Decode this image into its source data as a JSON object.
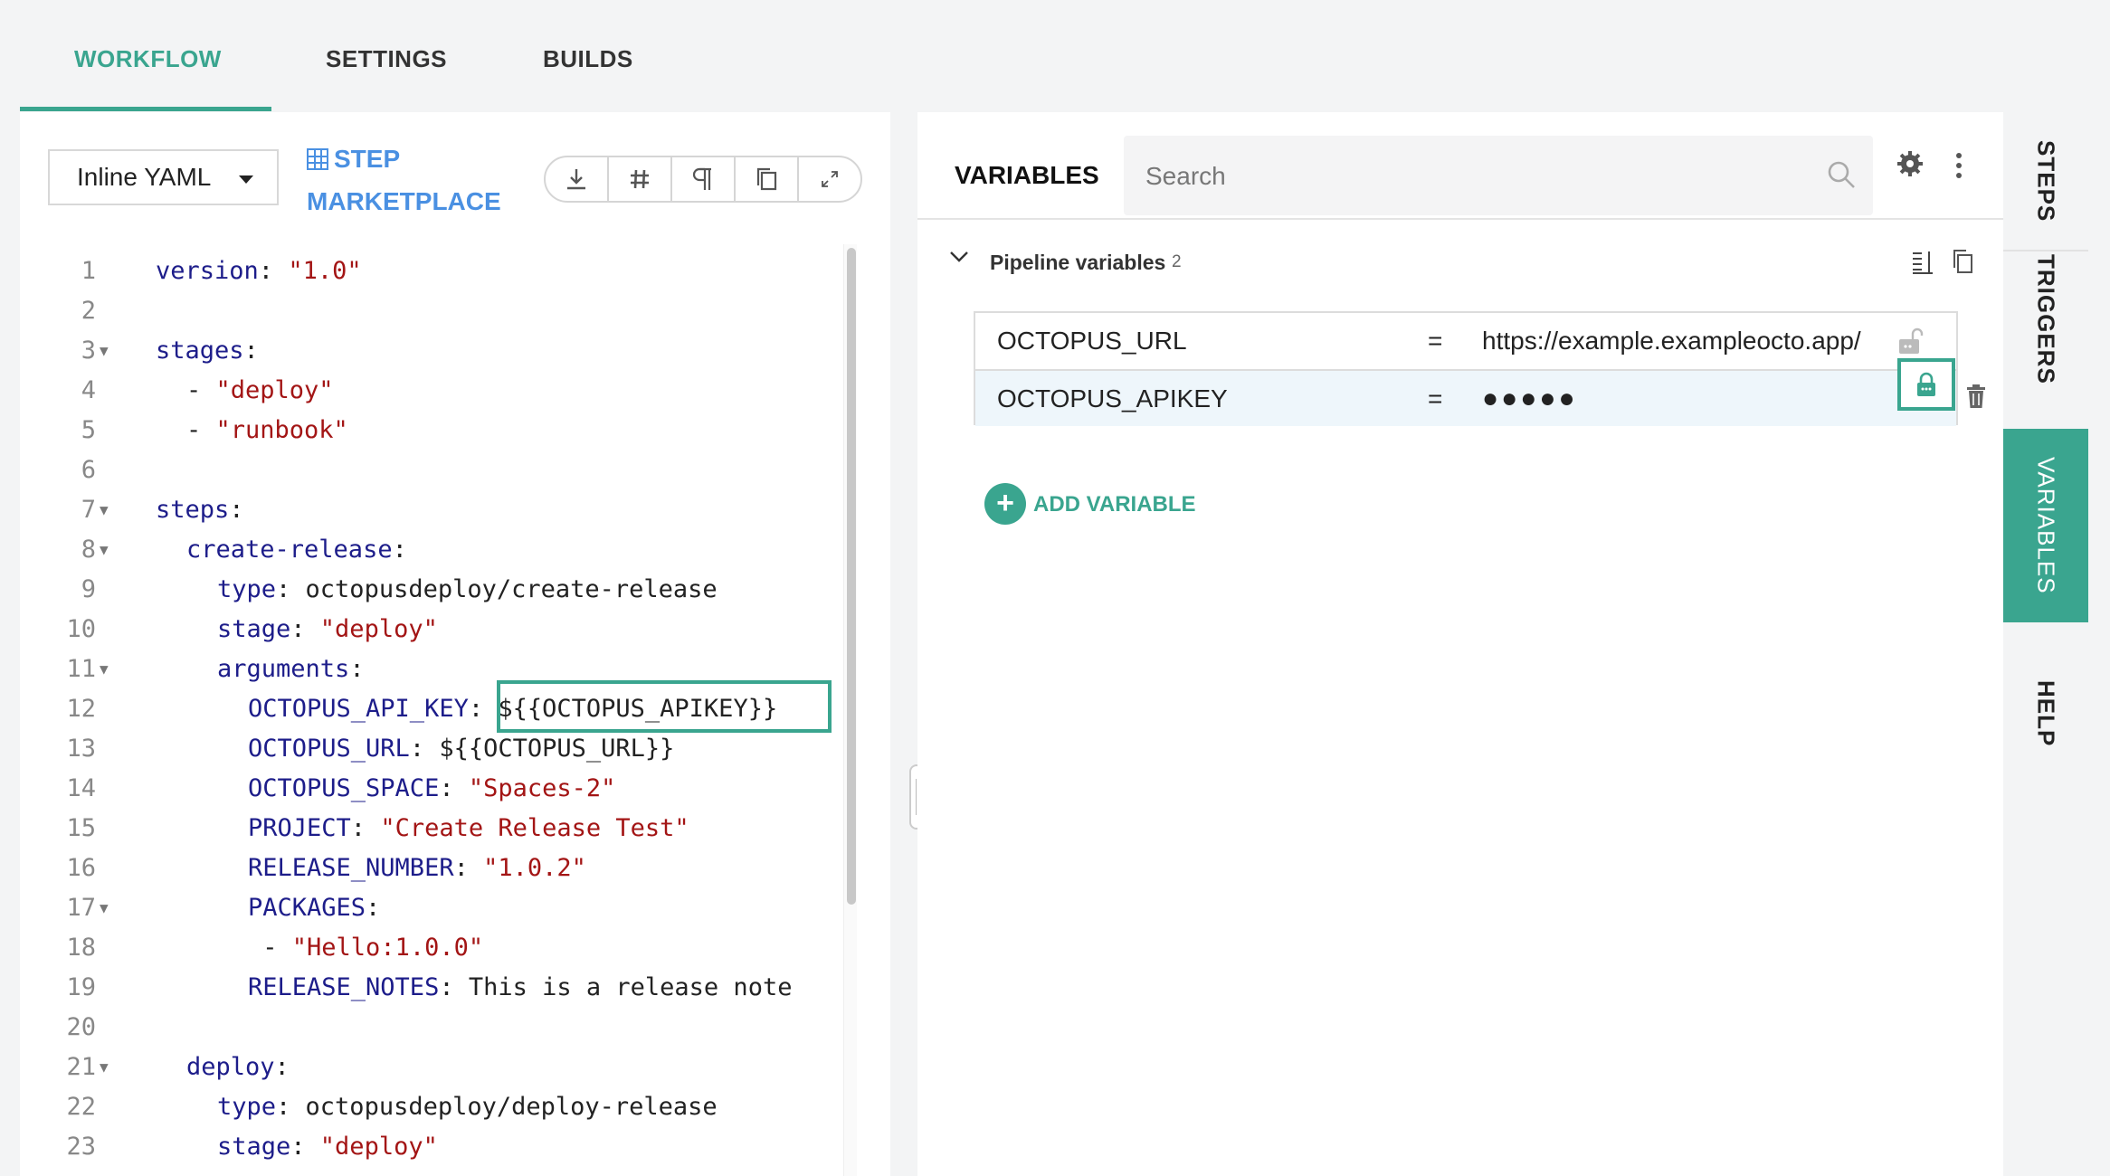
{
  "top_tabs": [
    {
      "label": "WORKFLOW",
      "active": true
    },
    {
      "label": "SETTINGS",
      "active": false
    },
    {
      "label": "BUILDS",
      "active": false
    }
  ],
  "editor": {
    "format_select": "Inline YAML",
    "step_marketplace": "STEP MARKETPLACE",
    "toolbar_icons": [
      "download-icon",
      "hash-icon",
      "pilcrow-icon",
      "copy-icon",
      "expand-icon"
    ],
    "lines": [
      {
        "n": "1",
        "fold": false,
        "indent": 0,
        "segs": [
          {
            "t": "version",
            "c": "k"
          },
          {
            "t": ": ",
            "c": "p"
          },
          {
            "t": "\"1.0\"",
            "c": "s"
          }
        ]
      },
      {
        "n": "2",
        "fold": false,
        "indent": 0,
        "segs": []
      },
      {
        "n": "3",
        "fold": true,
        "indent": 0,
        "segs": [
          {
            "t": "stages",
            "c": "k"
          },
          {
            "t": ":",
            "c": "p"
          }
        ]
      },
      {
        "n": "4",
        "fold": false,
        "indent": 1,
        "segs": [
          {
            "t": "- ",
            "c": "p"
          },
          {
            "t": "\"deploy\"",
            "c": "s"
          }
        ]
      },
      {
        "n": "5",
        "fold": false,
        "indent": 1,
        "segs": [
          {
            "t": "- ",
            "c": "p"
          },
          {
            "t": "\"runbook\"",
            "c": "s"
          }
        ]
      },
      {
        "n": "6",
        "fold": false,
        "indent": 0,
        "segs": []
      },
      {
        "n": "7",
        "fold": true,
        "indent": 0,
        "segs": [
          {
            "t": "steps",
            "c": "k"
          },
          {
            "t": ":",
            "c": "p"
          }
        ]
      },
      {
        "n": "8",
        "fold": true,
        "indent": 1,
        "segs": [
          {
            "t": "create-release",
            "c": "k"
          },
          {
            "t": ":",
            "c": "p"
          }
        ]
      },
      {
        "n": "9",
        "fold": false,
        "indent": 2,
        "segs": [
          {
            "t": "type",
            "c": "k"
          },
          {
            "t": ": octopusdeploy/create-release",
            "c": "p"
          }
        ]
      },
      {
        "n": "10",
        "fold": false,
        "indent": 2,
        "segs": [
          {
            "t": "stage",
            "c": "k"
          },
          {
            "t": ": ",
            "c": "p"
          },
          {
            "t": "\"deploy\"",
            "c": "s"
          }
        ]
      },
      {
        "n": "11",
        "fold": true,
        "indent": 2,
        "segs": [
          {
            "t": "arguments",
            "c": "k"
          },
          {
            "t": ":",
            "c": "p"
          }
        ]
      },
      {
        "n": "12",
        "fold": false,
        "indent": 3,
        "segs": [
          {
            "t": "OCTOPUS_API_KEY",
            "c": "k"
          },
          {
            "t": ": ${{OCTOPUS_APIKEY}}",
            "c": "p"
          }
        ]
      },
      {
        "n": "13",
        "fold": false,
        "indent": 3,
        "segs": [
          {
            "t": "OCTOPUS_URL",
            "c": "k"
          },
          {
            "t": ": ${{OCTOPUS_URL}}",
            "c": "p"
          }
        ]
      },
      {
        "n": "14",
        "fold": false,
        "indent": 3,
        "segs": [
          {
            "t": "OCTOPUS_SPACE",
            "c": "k"
          },
          {
            "t": ": ",
            "c": "p"
          },
          {
            "t": "\"Spaces-2\"",
            "c": "s"
          }
        ]
      },
      {
        "n": "15",
        "fold": false,
        "indent": 3,
        "segs": [
          {
            "t": "PROJECT",
            "c": "k"
          },
          {
            "t": ": ",
            "c": "p"
          },
          {
            "t": "\"Create Release Test\"",
            "c": "s"
          }
        ]
      },
      {
        "n": "16",
        "fold": false,
        "indent": 3,
        "segs": [
          {
            "t": "RELEASE_NUMBER",
            "c": "k"
          },
          {
            "t": ": ",
            "c": "p"
          },
          {
            "t": "\"1.0.2\"",
            "c": "s"
          }
        ]
      },
      {
        "n": "17",
        "fold": true,
        "indent": 3,
        "segs": [
          {
            "t": "PACKAGES",
            "c": "k"
          },
          {
            "t": ":",
            "c": "p"
          }
        ]
      },
      {
        "n": "18",
        "fold": false,
        "indent": 3,
        "segs": [
          {
            "t": " - ",
            "c": "p"
          },
          {
            "t": "\"Hello:1.0.0\"",
            "c": "s"
          }
        ]
      },
      {
        "n": "19",
        "fold": false,
        "indent": 3,
        "segs": [
          {
            "t": "RELEASE_NOTES",
            "c": "k"
          },
          {
            "t": ": This is a release note",
            "c": "p"
          }
        ]
      },
      {
        "n": "20",
        "fold": false,
        "indent": 0,
        "segs": []
      },
      {
        "n": "21",
        "fold": true,
        "indent": 1,
        "segs": [
          {
            "t": "deploy",
            "c": "k"
          },
          {
            "t": ":",
            "c": "p"
          }
        ]
      },
      {
        "n": "22",
        "fold": false,
        "indent": 2,
        "segs": [
          {
            "t": "type",
            "c": "k"
          },
          {
            "t": ": octopusdeploy/deploy-release",
            "c": "p"
          }
        ]
      },
      {
        "n": "23",
        "fold": false,
        "indent": 2,
        "segs": [
          {
            "t": "stage",
            "c": "k"
          },
          {
            "t": ": ",
            "c": "p"
          },
          {
            "t": "\"deploy\"",
            "c": "s"
          }
        ]
      }
    ]
  },
  "variables": {
    "title": "VARIABLES",
    "search_placeholder": "Search",
    "section_label": "Pipeline variables",
    "section_count": "2",
    "rows": [
      {
        "name": "OCTOPUS_URL",
        "eq": "=",
        "value": "https://example.exampleocto.app/",
        "encrypted": false
      },
      {
        "name": "OCTOPUS_APIKEY",
        "eq": "=",
        "value": "●●●●●",
        "encrypted": true
      }
    ],
    "add_label": "ADD VARIABLE",
    "add_symbol": "+"
  },
  "side_tabs": [
    {
      "label": "STEPS",
      "active": false
    },
    {
      "label": "TRIGGERS",
      "active": false
    },
    {
      "label": "VARIABLES",
      "active": true
    },
    {
      "label": "HELP",
      "active": false
    }
  ],
  "colors": {
    "accent": "#3aa58f",
    "link": "#4a90e2",
    "yaml_key": "#1d1d8a",
    "yaml_string": "#a31515"
  }
}
